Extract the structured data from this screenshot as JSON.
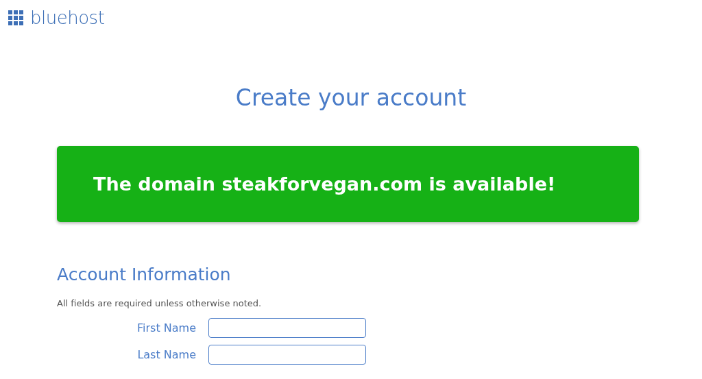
{
  "header": {
    "logo_text": "bluehost"
  },
  "page_title": "Create your account",
  "banner": {
    "message": "The domain steakforvegan.com is available!"
  },
  "section": {
    "title": "Account Information",
    "note": "All fields are required unless otherwise noted."
  },
  "fields": [
    {
      "label": "First Name"
    },
    {
      "label": "Last Name"
    }
  ]
}
